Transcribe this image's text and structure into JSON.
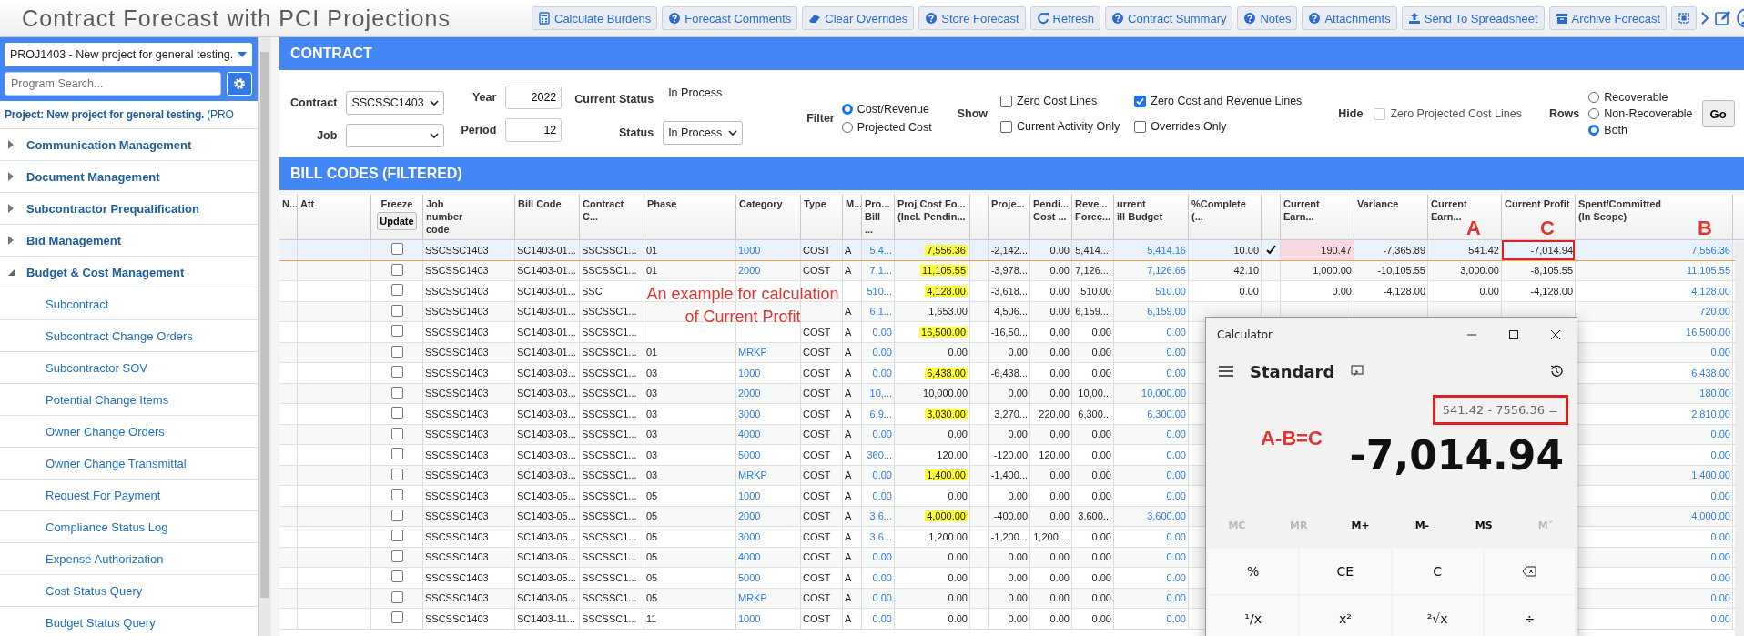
{
  "app": {
    "title": "Contract Forecast with PCI Projections"
  },
  "toolbar": {
    "buttons": [
      {
        "label": "Calculate Burdens",
        "kind": "calculator"
      },
      {
        "label": "Forecast Comments",
        "kind": "help"
      },
      {
        "label": "Clear Overrides",
        "kind": "eraser"
      },
      {
        "label": "Store Forecast",
        "kind": "help"
      },
      {
        "label": "Refresh",
        "kind": "refresh"
      },
      {
        "label": "Contract Summary",
        "kind": "help"
      },
      {
        "label": "Notes",
        "kind": "help"
      },
      {
        "label": "Attachments",
        "kind": "help"
      },
      {
        "label": "Send To Spreadsheet",
        "kind": "upload"
      },
      {
        "label": "Archive Forecast",
        "kind": "archive"
      },
      {
        "kind": "select"
      }
    ]
  },
  "sidebar": {
    "project_select": "PROJ1403 - New project for general testing.",
    "search": {
      "placeholder": "Program Search..."
    },
    "project_heading": "**Project: New project for general testing.** (PRO",
    "tree": [
      {
        "label": "Communication Management",
        "expanded": false
      },
      {
        "label": "Document Management",
        "expanded": false
      },
      {
        "label": "Subcontractor Prequalification",
        "expanded": false
      },
      {
        "label": "Bid Management",
        "expanded": false
      },
      {
        "label": "Budget & Cost Management",
        "expanded": true,
        "children": [
          {
            "label": "Subcontract"
          },
          {
            "label": "Subcontract Change Orders"
          },
          {
            "label": "Subcontractor SOV"
          },
          {
            "label": "Potential Change Items"
          },
          {
            "label": "Owner Change Orders"
          },
          {
            "label": "Owner Change Transmittal"
          },
          {
            "label": "Request For Payment"
          },
          {
            "label": "Compliance Status Log"
          },
          {
            "label": "Expense Authorization"
          },
          {
            "label": "Cost Status Query"
          },
          {
            "label": "Budget Status Query"
          }
        ]
      }
    ]
  },
  "contract": {
    "title": "CONTRACT",
    "contract": {
      "label": "Contract",
      "value": "SSCSSC1403"
    },
    "job": {
      "label": "Job"
    },
    "year": {
      "label": "Year",
      "value": "2022"
    },
    "period": {
      "label": "Period",
      "value": "12"
    },
    "current_status": {
      "label": "Current Status",
      "value": "In Process"
    },
    "status": {
      "label": "Status",
      "value": "In Process"
    },
    "filter": {
      "label": "Filter",
      "options": [
        {
          "label": "Cost/Revenue",
          "selected": true
        },
        {
          "label": "Projected Cost",
          "selected": false
        }
      ]
    },
    "show": {
      "label": "Show",
      "options": [
        {
          "label": "Zero Cost Lines",
          "checked": false
        },
        {
          "label": "Current Activity Only",
          "checked": false
        },
        {
          "label": "Zero Cost and Revenue Lines",
          "checked": true
        },
        {
          "label": "Overrides Only",
          "checked": false
        }
      ]
    },
    "hide": {
      "label": "Hide",
      "options": [
        {
          "label": "Zero Projected Cost Lines",
          "checked": false,
          "disabled": true
        }
      ]
    },
    "rows": {
      "label": "Rows",
      "options": [
        {
          "label": "Recoverable",
          "selected": false
        },
        {
          "label": "Non-Recoverable",
          "selected": false
        },
        {
          "label": "Both",
          "selected": true
        }
      ]
    },
    "go": "Go"
  },
  "bill_codes": {
    "title": "BILL CODES (FILTERED)",
    "columns": [
      {
        "label": "N..."
      },
      {
        "label": "Att"
      },
      {
        "label": "Freeze",
        "button": "Update"
      },
      {
        "label": "Job\nnumber\ncode"
      },
      {
        "label": "Bill Code"
      },
      {
        "label": "Contract C..."
      },
      {
        "label": "Phase"
      },
      {
        "label": "Category"
      },
      {
        "label": "Type"
      },
      {
        "label": "M..."
      },
      {
        "label": "Pro...\nBill ..."
      },
      {
        "label": "Proj Cost Fo...\n(Incl. Pendin..."
      },
      {},
      {
        "label": "Proje..."
      },
      {
        "label": "Pendi...\nCost ..."
      },
      {
        "label": "Reve...\nForec..."
      },
      {
        "label": "urrent\nill Budget"
      },
      {
        "label": "%Complete (..."
      },
      {},
      {
        "label": "Current Earn..."
      },
      {
        "label": "Variance"
      },
      {
        "label": "Current Earn...",
        "annotation": "A"
      },
      {
        "label": "Current Profit",
        "annotation": "C"
      },
      {
        "label": "Spent/Committed\n(In Scope)",
        "annotation": "B"
      }
    ],
    "rows": [
      {
        "selected": true,
        "freeze": false,
        "job": "SSCSSC1403",
        "bill_code": "SC1403-01...",
        "contract_code": "SSCSSC1...",
        "phase": "01",
        "category": "1000",
        "type": "COST",
        "m": "A",
        "pro_bill": "5,4...",
        "proj_cost": "7,556.36",
        "proj_cost_highlighted": true,
        "proje": "-2,142...",
        "pending_cost": "0.00",
        "revenue_forecast": "5,414....",
        "current_bill_budget": "5,414.16",
        "pct_complete": "10.00",
        "complete_checked": true,
        "current_earned": "190.47",
        "current_earned_flagged": true,
        "variance": "-7,365.89",
        "current_earned_2": "541.42",
        "current_profit": "-7,014.94",
        "current_profit_boxed": true,
        "spent_committed": "7,556.36"
      },
      {
        "selected": false,
        "freeze": false,
        "job": "SSCSSC1403",
        "bill_code": "SC1403-01...",
        "contract_code": "SSCSSC1...",
        "phase": "01",
        "category": "2000",
        "type": "COST",
        "m": "A",
        "pro_bill": "7,1...",
        "proj_cost": "11,105.55",
        "proj_cost_highlighted": true,
        "proje": "-3,978...",
        "pending_cost": "0.00",
        "revenue_forecast": "7,126....",
        "current_bill_budget": "7,126.65",
        "pct_complete": "42.10",
        "complete_checked": false,
        "current_earned": "1,000.00",
        "current_earned_flagged": false,
        "variance": "-10,105.55",
        "current_earned_2": "3,000.00",
        "current_profit": "-8,105.55",
        "current_profit_boxed": false,
        "spent_committed": "11,105.55"
      },
      {
        "selected": false,
        "freeze": false,
        "job": "SSCSSC1403",
        "bill_code": "SC1403-01...",
        "contract_code": "SSC",
        "pro_bill": "510...",
        "proj_cost": "4,128.00",
        "proj_cost_highlighted": true,
        "proje": "-3,618...",
        "pending_cost": "0.00",
        "revenue_forecast": "510.00",
        "current_bill_budget": "510.00",
        "pct_complete": "0.00",
        "complete_checked": false,
        "current_earned": "0.00",
        "current_earned_flagged": false,
        "variance": "-4,128.00",
        "current_earned_2": "0.00",
        "current_profit": "-4,128.00",
        "current_profit_boxed": false,
        "spent_committed": "4,128.00"
      },
      {
        "selected": false,
        "freeze": false,
        "job": "SSCSSC1403",
        "bill_code": "SC1403-01...",
        "contract_code": "SSCSSC1...",
        "m": "A",
        "pro_bill": "6,1...",
        "proj_cost": "1,653.00",
        "proj_cost_highlighted": false,
        "proje": "4,506...",
        "pending_cost": "0.00",
        "revenue_forecast": "6,159....",
        "current_bill_budget": "6,159.00",
        "spent_committed": "720.00"
      },
      {
        "selected": false,
        "freeze": false,
        "job": "SSCSSC1403",
        "bill_code": "SC1403-01...",
        "contract_code": "SSCSSC1...",
        "type": "COST",
        "m": "A",
        "pro_bill": "0.00",
        "proj_cost": "16,500.00",
        "proj_cost_highlighted": true,
        "proje": "-16,50...",
        "pending_cost": "0.00",
        "revenue_forecast": "0.00",
        "current_bill_budget": "0.00",
        "spent_committed": "16,500.00"
      },
      {
        "selected": false,
        "freeze": false,
        "job": "SSCSSC1403",
        "bill_code": "SC1403-01...",
        "contract_code": "SSCSSC1...",
        "phase": "01",
        "category": "MRKP",
        "type": "COST",
        "m": "A",
        "pro_bill": "0.00",
        "proj_cost": "0.00",
        "proj_cost_highlighted": false,
        "proje": "0.00",
        "pending_cost": "0.00",
        "revenue_forecast": "0.00",
        "current_bill_budget": "0.00",
        "spent_committed": "0.00"
      },
      {
        "selected": false,
        "freeze": false,
        "job": "SSCSSC1403",
        "bill_code": "SC1403-03...",
        "contract_code": "SSCSSC1...",
        "phase": "03",
        "category": "1000",
        "type": "COST",
        "m": "A",
        "pro_bill": "0.00",
        "proj_cost": "6,438.00",
        "proj_cost_highlighted": true,
        "proje": "-6,438...",
        "pending_cost": "0.00",
        "revenue_forecast": "0.00",
        "current_bill_budget": "0.00",
        "spent_committed": "6,438.00"
      },
      {
        "selected": false,
        "freeze": false,
        "job": "SSCSSC1403",
        "bill_code": "SC1403-03...",
        "contract_code": "SSCSSC1...",
        "phase": "03",
        "category": "2000",
        "type": "COST",
        "m": "A",
        "pro_bill": "10,...",
        "proj_cost": "10,000.00",
        "proj_cost_highlighted": false,
        "proje": "0.00",
        "pending_cost": "0.00",
        "revenue_forecast": "10,00...",
        "current_bill_budget": "10,000.00",
        "spent_committed": "180.00"
      },
      {
        "selected": false,
        "freeze": false,
        "job": "SSCSSC1403",
        "bill_code": "SC1403-03...",
        "contract_code": "SSCSSC1...",
        "phase": "03",
        "category": "3000",
        "type": "COST",
        "m": "A",
        "pro_bill": "6,9...",
        "proj_cost": "3,030.00",
        "proj_cost_highlighted": true,
        "proje": "3,270...",
        "pending_cost": "220.00",
        "revenue_forecast": "6,300...",
        "current_bill_budget": "6,300.00",
        "spent_committed": "2,810.00"
      },
      {
        "selected": false,
        "freeze": false,
        "job": "SSCSSC1403",
        "bill_code": "SC1403-03...",
        "contract_code": "SSCSSC1...",
        "phase": "03",
        "category": "4000",
        "type": "COST",
        "m": "A",
        "pro_bill": "0.00",
        "proj_cost": "0.00",
        "proj_cost_highlighted": false,
        "proje": "0.00",
        "pending_cost": "0.00",
        "revenue_forecast": "0.00",
        "current_bill_budget": "0.00",
        "spent_committed": "0.00"
      },
      {
        "selected": false,
        "freeze": false,
        "job": "SSCSSC1403",
        "bill_code": "SC1403-03...",
        "contract_code": "SSCSSC1...",
        "phase": "03",
        "category": "5000",
        "type": "COST",
        "m": "A",
        "pro_bill": "360...",
        "proj_cost": "120.00",
        "proj_cost_highlighted": false,
        "proje": "-120.00",
        "pending_cost": "120.00",
        "revenue_forecast": "0.00",
        "current_bill_budget": "0.00",
        "spent_committed": "0.00"
      },
      {
        "selected": false,
        "freeze": false,
        "job": "SSCSSC1403",
        "bill_code": "SC1403-03...",
        "contract_code": "SSCSSC1...",
        "phase": "03",
        "category": "MRKP",
        "type": "COST",
        "m": "A",
        "pro_bill": "0.00",
        "proj_cost": "1,400.00",
        "proj_cost_highlighted": true,
        "proje": "-1,400...",
        "pending_cost": "0.00",
        "revenue_forecast": "0.00",
        "current_bill_budget": "0.00",
        "spent_committed": "1,400.00"
      },
      {
        "selected": false,
        "freeze": false,
        "job": "SSCSSC1403",
        "bill_code": "SC1403-05...",
        "contract_code": "SSCSSC1...",
        "phase": "05",
        "category": "1000",
        "type": "COST",
        "m": "A",
        "pro_bill": "0.00",
        "proj_cost": "0.00",
        "proj_cost_highlighted": false,
        "proje": "0.00",
        "pending_cost": "0.00",
        "revenue_forecast": "0.00",
        "current_bill_budget": "0.00",
        "spent_committed": "0.00"
      },
      {
        "selected": false,
        "freeze": false,
        "job": "SSCSSC1403",
        "bill_code": "SC1403-05...",
        "contract_code": "SSCSSC1...",
        "phase": "05",
        "category": "2000",
        "type": "COST",
        "m": "A",
        "pro_bill": "3,6...",
        "proj_cost": "4,000.00",
        "proj_cost_highlighted": true,
        "proje": "-400.00",
        "pending_cost": "0.00",
        "revenue_forecast": "3,600...",
        "current_bill_budget": "3,600.00",
        "spent_committed": "4,000.00"
      },
      {
        "selected": false,
        "freeze": false,
        "job": "SSCSSC1403",
        "bill_code": "SC1403-05...",
        "contract_code": "SSCSSC1...",
        "phase": "05",
        "category": "3000",
        "type": "COST",
        "m": "A",
        "pro_bill": "3,6...",
        "proj_cost": "1,200.00",
        "proj_cost_highlighted": false,
        "proje": "-1,200...",
        "pending_cost": "1,200....",
        "revenue_forecast": "0.00",
        "current_bill_budget": "0.00",
        "spent_committed": "0.00"
      },
      {
        "selected": false,
        "freeze": false,
        "job": "SSCSSC1403",
        "bill_code": "SC1403-05...",
        "contract_code": "SSCSSC1...",
        "phase": "05",
        "category": "4000",
        "type": "COST",
        "m": "A",
        "pro_bill": "0.00",
        "proj_cost": "0.00",
        "proj_cost_highlighted": false,
        "proje": "0.00",
        "pending_cost": "0.00",
        "revenue_forecast": "0.00",
        "current_bill_budget": "0.00",
        "spent_committed": "0.00"
      },
      {
        "selected": false,
        "freeze": false,
        "job": "SSCSSC1403",
        "bill_code": "SC1403-05...",
        "contract_code": "SSCSSC1...",
        "phase": "05",
        "category": "5000",
        "type": "COST",
        "m": "A",
        "pro_bill": "0.00",
        "proj_cost": "0.00",
        "proj_cost_highlighted": false,
        "proje": "0.00",
        "pending_cost": "0.00",
        "revenue_forecast": "0.00",
        "current_bill_budget": "0.00",
        "spent_committed": "0.00"
      },
      {
        "selected": false,
        "freeze": false,
        "job": "SSCSSC1403",
        "bill_code": "SC1403-05...",
        "contract_code": "SSCSSC1...",
        "phase": "05",
        "category": "MRKP",
        "type": "COST",
        "m": "A",
        "pro_bill": "0.00",
        "proj_cost": "0.00",
        "proj_cost_highlighted": false,
        "proje": "0.00",
        "pending_cost": "0.00",
        "revenue_forecast": "0.00",
        "current_bill_budget": "0.00",
        "spent_committed": "0.00"
      },
      {
        "selected": false,
        "freeze": false,
        "job": "SSCSSC1403",
        "bill_code": "SC1403-11...",
        "contract_code": "SSCSSC1...",
        "phase": "11",
        "category": "1000",
        "type": "COST",
        "m": "A",
        "pro_bill": "0.00",
        "proj_cost": "0.00",
        "proj_cost_highlighted": false,
        "proje": "0.00",
        "pending_cost": "0.00",
        "revenue_forecast": "0.00",
        "current_bill_budget": "0.00",
        "spent_committed": "0.00"
      }
    ]
  },
  "annotations": {
    "note": "An example for calculation of Current Profit",
    "formula": "A-B=C"
  },
  "calculator": {
    "title": "Calculator",
    "mode": "Standard",
    "expression": "541.42 - 7556.36 =",
    "expression_boxed": true,
    "result": "-7,014.94",
    "memory": [
      {
        "label": "MC",
        "disabled": true
      },
      {
        "label": "MR",
        "disabled": true
      },
      {
        "label": "M+",
        "disabled": false
      },
      {
        "label": "M-",
        "disabled": false
      },
      {
        "label": "MS",
        "disabled": false
      },
      {
        "label": "M˅",
        "disabled": true
      }
    ],
    "keys": [
      {
        "kind": "text",
        "label": "%"
      },
      {
        "kind": "text",
        "label": "CE"
      },
      {
        "kind": "text",
        "label": "C"
      },
      {
        "kind": "backspace"
      },
      {
        "kind": "text",
        "label": "¹/x"
      },
      {
        "kind": "text",
        "label": "x²"
      },
      {
        "kind": "text",
        "label": "²√x"
      },
      {
        "kind": "text",
        "label": "÷"
      }
    ]
  }
}
